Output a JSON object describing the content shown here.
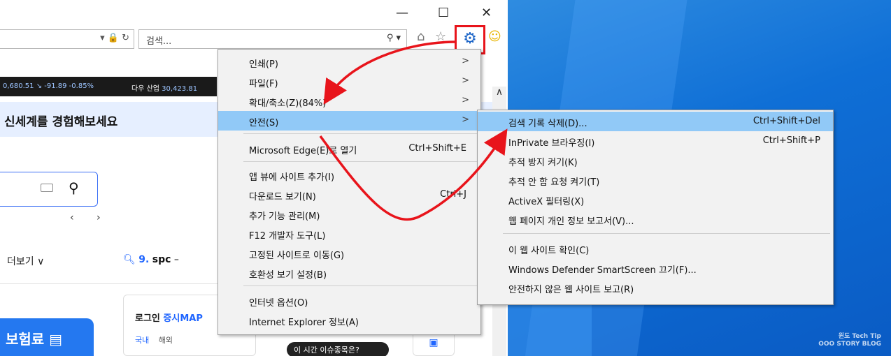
{
  "window": {
    "minimize": "—",
    "maximize": "☐",
    "close": "✕"
  },
  "address": {
    "tools": "▾ 🔒 ↻"
  },
  "search": {
    "placeholder": "검색...",
    "tools": "⚲ ▾"
  },
  "toolbar_icons": [
    "home-icon",
    "favorites-star-icon",
    "gear-icon",
    "smiley-feedback-icon"
  ],
  "ticker": {
    "left": "0,680.51 ↘ -91.89 -0.85%",
    "dow_label": "다우 산업",
    "dow_value": "30,423.81"
  },
  "page": {
    "banner": "신세계를 경험해보세요",
    "pager": "‹ ›",
    "more": "더보기 ∨",
    "rank_num": "9.",
    "rank_term": "spc",
    "rank_dash": "–",
    "blue_card": "보험료 ▤",
    "login": "로그인",
    "login_suffix": "증시MAP",
    "tab_domestic": "국내",
    "tab_foreign": "해외",
    "pill": "이 시간 이슈종목은?"
  },
  "tools_menu": {
    "items": [
      {
        "label": "인쇄(P)",
        "arrow": ">"
      },
      {
        "label": "파일(F)",
        "arrow": ">"
      },
      {
        "label": "확대/축소(Z)(84%)",
        "arrow": ">"
      },
      {
        "label": "안전(S)",
        "arrow": ">"
      },
      {
        "label": "Microsoft Edge(E)로 열기",
        "shortcut": "Ctrl+Shift+E"
      },
      {
        "label": "앱 뷰에 사이트 추가(I)"
      },
      {
        "label": "다운로드 보기(N)",
        "shortcut": "Ctrl+J"
      },
      {
        "label": "추가 기능 관리(M)"
      },
      {
        "label": "F12 개발자 도구(L)"
      },
      {
        "label": "고정된 사이트로 이동(G)"
      },
      {
        "label": "호환성 보기 설정(B)"
      },
      {
        "label": "인터넷 옵션(O)"
      },
      {
        "label": "Internet Explorer 정보(A)"
      }
    ]
  },
  "safety_submenu": {
    "items": [
      {
        "label": "검색 기록 삭제(D)...",
        "shortcut": "Ctrl+Shift+Del"
      },
      {
        "label": "InPrivate 브라우징(I)",
        "shortcut": "Ctrl+Shift+P"
      },
      {
        "label": "추적 방지 켜기(K)"
      },
      {
        "label": "추적 안 함 요청 켜기(T)"
      },
      {
        "label": "ActiveX 필터링(X)"
      },
      {
        "label": "웹 페이지 개인 정보 보고서(V)..."
      },
      {
        "label": "이 웹 사이트 확인(C)"
      },
      {
        "label": "Windows Defender SmartScreen 끄기(F)..."
      },
      {
        "label": "안전하지 않은 웹 사이트 보고(R)"
      }
    ]
  },
  "watermark": {
    "line1": "윈도 Tech Tip",
    "line2": "OOO STORY BLOG"
  },
  "colors": {
    "highlight": "#91c9f7",
    "annotation_red": "#e8141b",
    "gear_blue": "#1b64c7"
  }
}
